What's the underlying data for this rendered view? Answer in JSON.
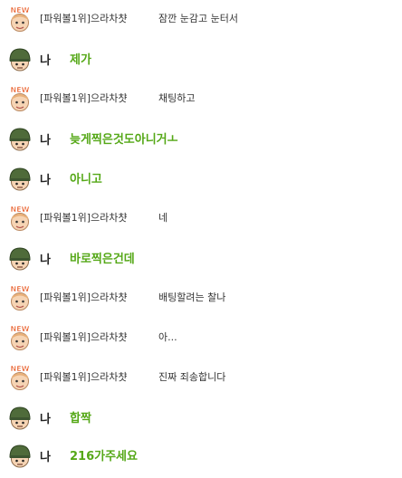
{
  "chat": {
    "messages": [
      {
        "sender": "[파워볼1위]으라차챳",
        "type": "other",
        "text": "잠깐 눈감고 눈터서"
      },
      {
        "sender": "나",
        "type": "me",
        "text": "제가"
      },
      {
        "sender": "[파워볼1위]으라차챳",
        "type": "other",
        "text": "채팅하고"
      },
      {
        "sender": "나",
        "type": "me",
        "text": "늦게찍은것도아니거ㅗ"
      },
      {
        "sender": "나",
        "type": "me",
        "text": "아니고"
      },
      {
        "sender": "[파워볼1위]으라차챳",
        "type": "other",
        "text": "네"
      },
      {
        "sender": "나",
        "type": "me",
        "text": "바로찍은건데"
      },
      {
        "sender": "[파워볼1위]으라차챳",
        "type": "other",
        "text": "배팅할려는 찰나"
      },
      {
        "sender": "[파워볼1위]으라차챳",
        "type": "other",
        "text": "아..."
      },
      {
        "sender": "[파워볼1위]으라차챳",
        "type": "other",
        "text": "진짜 죄송합니다"
      },
      {
        "sender": "나",
        "type": "me",
        "text": "합짝"
      },
      {
        "sender": "나",
        "type": "me",
        "text": "216가주세요"
      }
    ]
  },
  "avatar_badge_text": "NEW",
  "colors": {
    "my_message": "#55a817",
    "other_text": "#333333",
    "new_badge": "#e8541c",
    "helmet": "#4f6b3a"
  }
}
